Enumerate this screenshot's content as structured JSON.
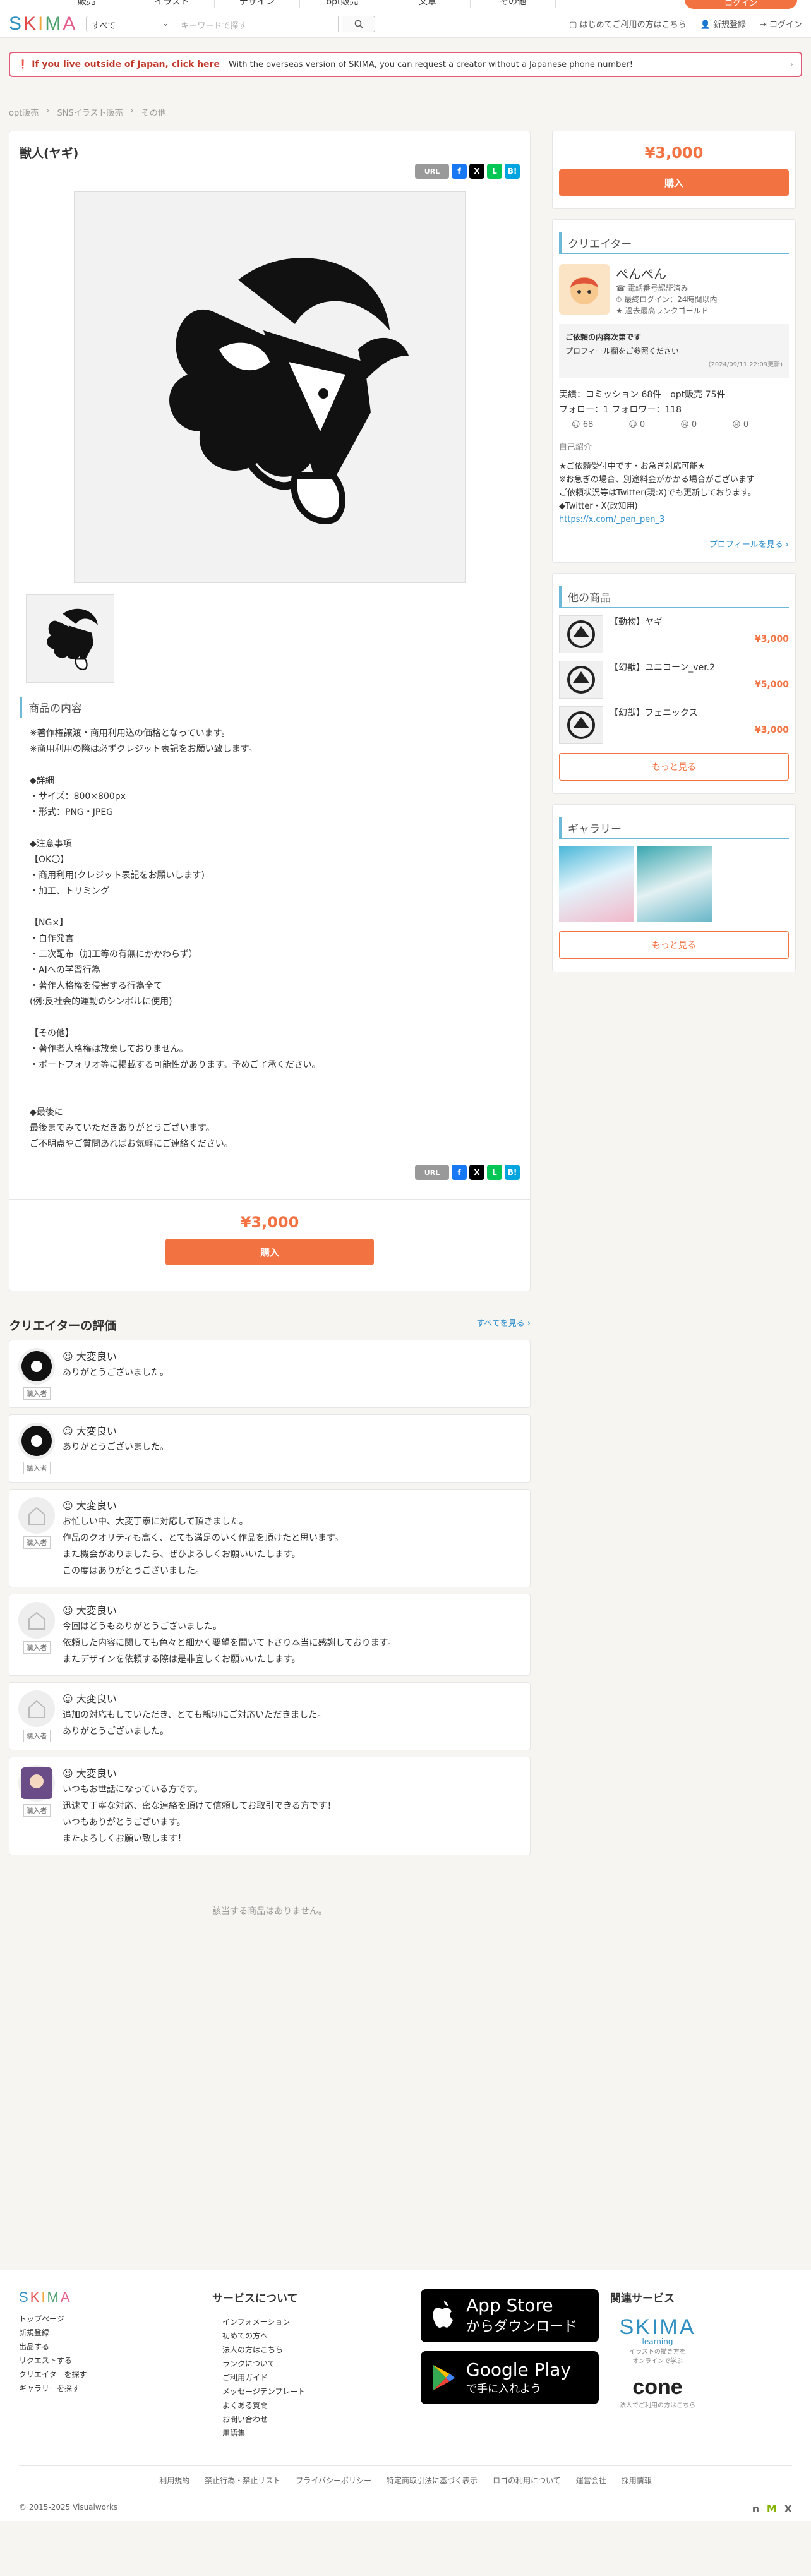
{
  "topnav": {
    "items": [
      "販売",
      "イラスト",
      "デザイン",
      "opt販売",
      "文章",
      "その他"
    ],
    "pill": "ログイン"
  },
  "header": {
    "logo": "SKIMA",
    "category": "すべて",
    "search_placeholder": "キーワードで探す",
    "links": [
      "はじめてご利用の方はこちら",
      "新規登録",
      "ログイン"
    ]
  },
  "notice": {
    "bold": "If you live outside of Japan, click here",
    "text": "With the overseas version of SKIMA, you can request a creator without a Japanese phone number!"
  },
  "breadcrumb": [
    "opt販売",
    "SNSイラスト販売",
    "その他"
  ],
  "work": {
    "title": "獣人(ヤギ)",
    "url_label": "URL",
    "desc_heading": "商品の内容",
    "description": "※著作権譲渡・商用利用込の価格となっています。\n※商用利用の際は必ずクレジット表記をお願い致します。\n\n◆詳細\n・サイズ：800×800px\n・形式：PNG・JPEG\n\n◆注意事項\n【OK〇】\n・商用利用(クレジット表記をお願いします)\n・加工、トリミング\n\n【NG×】\n・自作発言\n・二次配布（加工等の有無にかかわらず）\n・AIへの学習行為\n・著作人格権を侵害する行為全て\n(例:反社会的運動のシンボルに使用)\n\n【その他】\n・著作者人格権は放棄しておりません。\n・ポートフォリオ等に掲載する可能性があります。予めご了承ください。\n\n\n◆最後に\n最後までみていただきありがとうございます。\nご不明点やご質問あればお気軽にご連絡ください。",
    "price": "¥3,000",
    "buy_label": "購入"
  },
  "side": {
    "price": "¥3,000",
    "buy_label": "購入",
    "creator_heading": "クリエイター",
    "creator_name": "ぺんぺん",
    "creator_meta": [
      "電話番号認証済み",
      "最終ログイン：24時間以内",
      "過去最高ランクゴールド"
    ],
    "profile_title": "ご依頼の内容次第です",
    "profile_text": "プロフィール欄をご参照ください",
    "profile_date": "(2024/09/11 22:09更新)",
    "stats1": "実績：コミッション 68件　opt販売 75件",
    "stats2": "フォロー：1 フォロワー：118",
    "faces": [
      "68",
      "0",
      "0",
      "0"
    ],
    "intro_heading": "自己紹介",
    "intro": "★ご依頼受付中です・お急ぎ対応可能★\n※お急ぎの場合、別途料金がかかる場合がございます\nご依頼状況等はTwitter(現:X)でも更新しております。\n◆Twitter・X(改知用)",
    "intro_link": "https://x.com/_pen_pen_3",
    "profile_more": "プロフィールを見る ›",
    "other_heading": "他の商品",
    "other_items": [
      {
        "name": "【動物】ヤギ",
        "price": "¥3,000"
      },
      {
        "name": "【幻獣】ユニコーン_ver.2",
        "price": "¥5,000"
      },
      {
        "name": "【幻獣】フェニックス",
        "price": "¥3,000"
      }
    ],
    "more_label": "もっと見る",
    "gallery_heading": "ギャラリー",
    "gallery_more": "もっと見る"
  },
  "reviews": {
    "heading": "クリエイターの評価",
    "see_all": "すべてを見る ›",
    "tag": "購入者",
    "items": [
      {
        "rating": "大変良い",
        "text": "ありがとうございました。"
      },
      {
        "rating": "大変良い",
        "text": "ありがとうございました。"
      },
      {
        "rating": "大変良い",
        "text": "お忙しい中、大変丁寧に対応して頂きました。\n作品のクオリティも高く、とても満足のいく作品を頂けたと思います。\nまた機会がありましたら、ぜひよろしくお願いいたします。\nこの度はありがとうございました。"
      },
      {
        "rating": "大変良い",
        "text": "今回はどうもありがとうございました。\n依頼した内容に関しても色々と細かく要望を聞いて下さり本当に感謝しております。\nまたデザインを依頼する際は是非宜しくお願いいたします。"
      },
      {
        "rating": "大変良い",
        "text": "追加の対応もしていただき、とても親切にご対応いただきました。\nありがとうございました。"
      },
      {
        "rating": "大変良い",
        "text": "いつもお世話になっている方です。\n迅速で丁寧な対応、密な連絡を頂けて信頼してお取引できる方です！\nいつもありがとうございます。\nまたよろしくお願い致します！"
      }
    ],
    "none_text": "該当する商品はありません。"
  },
  "footer": {
    "logo": "SKIMA",
    "col1": [
      "トップページ",
      "新規登録",
      "出品する",
      "リクエストする",
      "クリエイターを探す",
      "ギャラリーを探す"
    ],
    "col2_heading": "サービスについて",
    "col2": [
      "インフォメーション",
      "初めての方へ",
      "法人の方はこちら",
      "ランクについて",
      "ご利用ガイド",
      "メッセージテンプレート",
      "よくある質問",
      "お問い合わせ",
      "用語集"
    ],
    "appstore_1": "App Store",
    "appstore_2": "からダウンロード",
    "gplay_1": "Google Play",
    "gplay_2": "で手に入れよう",
    "col4_heading": "関連サービス",
    "skima_learning": "learning",
    "skima_learning_sub": "イラストの描き方を\nオンラインで学ぶ",
    "cone": "cone",
    "cone_sub": "法人でご利用の方はこちら",
    "bottom_links": [
      "利用規約",
      "禁止行為・禁止リスト",
      "プライバシーポリシー",
      "特定商取引法に基づく表示",
      "ロゴの利用について",
      "運営会社",
      "採用情報"
    ],
    "copyright": "© 2015-2025 Visualworks"
  }
}
